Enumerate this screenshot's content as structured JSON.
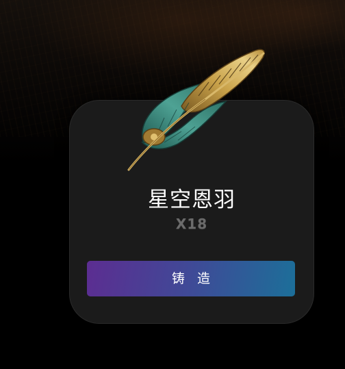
{
  "item": {
    "name": "星空恩羽",
    "count": "X18",
    "icon": "golden-teal-feather-icon"
  },
  "actions": {
    "forge_label": "铸 造"
  },
  "colors": {
    "background": "#000000",
    "card": "#1b1b1b",
    "button_gradient_start": "#5c2d91",
    "button_gradient_end": "#1c6f99",
    "name_text": "#ffffff",
    "count_text": "#6b6b6b"
  }
}
